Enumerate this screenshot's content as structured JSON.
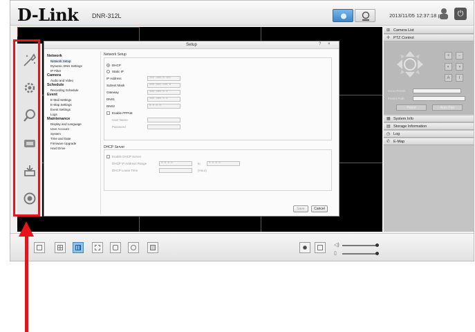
{
  "header": {
    "brand": "D-Link",
    "model": "DNR-312L",
    "datetime": "2013/11/05 12:37:18 pm"
  },
  "sidebar": {
    "items": [
      {
        "icon": "wizard-icon"
      },
      {
        "icon": "settings-gear-icon"
      },
      {
        "icon": "search-icon"
      },
      {
        "icon": "device-icon"
      },
      {
        "icon": "backup-icon"
      },
      {
        "icon": "status-icon"
      }
    ]
  },
  "dialog": {
    "title": "Setup",
    "help": "?",
    "close": "×",
    "menu": [
      {
        "type": "header",
        "label": "Network"
      },
      {
        "type": "item",
        "label": "Network Setup",
        "selected": true
      },
      {
        "type": "item",
        "label": "Dynamic DNS Settings"
      },
      {
        "type": "item",
        "label": "IP Filter"
      },
      {
        "type": "header",
        "label": "Camera"
      },
      {
        "type": "item",
        "label": "Audio and Video"
      },
      {
        "type": "header",
        "label": "Schedule"
      },
      {
        "type": "item",
        "label": "Recording Schedule"
      },
      {
        "type": "header",
        "label": "Event"
      },
      {
        "type": "item",
        "label": "E-Mail Settings"
      },
      {
        "type": "item",
        "label": "E-Map Settings"
      },
      {
        "type": "item",
        "label": "Event Settings"
      },
      {
        "type": "item",
        "label": "Logs"
      },
      {
        "type": "header",
        "label": "Maintenance"
      },
      {
        "type": "item",
        "label": "Display and Language"
      },
      {
        "type": "item",
        "label": "User Account"
      },
      {
        "type": "item",
        "label": "System"
      },
      {
        "type": "item",
        "label": "Time and Date"
      },
      {
        "type": "item",
        "label": "Firmware Upgrade"
      },
      {
        "type": "item",
        "label": "Hard Drive"
      }
    ],
    "network_setup": {
      "section_title": "Network Setup",
      "dhcp_label": "DHCP",
      "static_ip_label": "Static IP",
      "ip_label": "IP Address",
      "ip_value": "192.168.0.101",
      "mask_label": "Subnet Mask",
      "mask_value": "255.255.255.0",
      "gateway_label": "Gateway",
      "gateway_value": "192.168.0.1",
      "dns1_label": "DNS1",
      "dns1_value": "192.168.0.1",
      "dns2_label": "DNS2",
      "dns2_value": "0.0.0.0",
      "pppoe_label": "Enable PPPoE",
      "username_label": "User Name",
      "password_label": "Password"
    },
    "dhcp_server": {
      "section_title": "DHCP Server",
      "enable_label": "Enable DHCP Server",
      "range_label": "DHCP IP Address Range",
      "range_start": "0.0.0.0",
      "range_to": "to",
      "range_end": "0.0.0.0",
      "lease_label": "DHCP Lease Time",
      "lease_unit": "(Hour)"
    },
    "save_label": "Save",
    "cancel_label": "Cancel"
  },
  "right_panel": {
    "camera_list": "Camera List",
    "ptz_control": "PTZ Control",
    "goto_preset": "Go to Preset",
    "preset_path": "Preset Path",
    "patrol": "Patrol",
    "auto_pan": "Auto Pan",
    "system_info": "System Info",
    "storage_info": "Storage Information",
    "log": "Log",
    "emap": "E-Map"
  },
  "colors": {
    "highlight": "#e8141b",
    "accent": "#3f86c4"
  }
}
